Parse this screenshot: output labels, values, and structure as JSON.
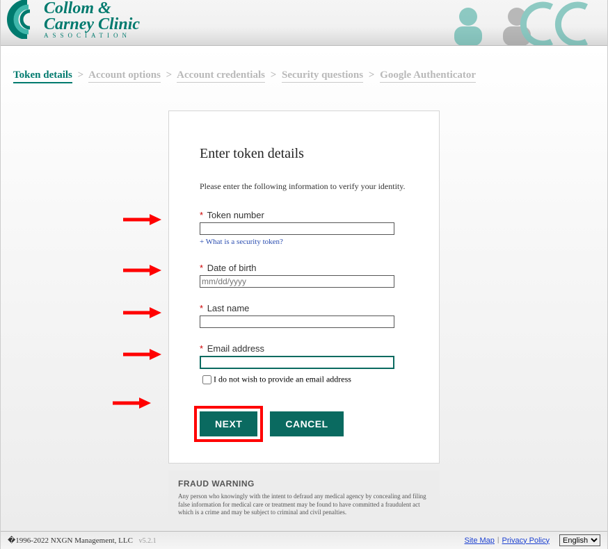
{
  "logo": {
    "line1": "Collom &",
    "line2": "Carney Clinic",
    "line3": "ASSOCIATION"
  },
  "breadcrumb": {
    "items": [
      {
        "label": "Token details",
        "active": true
      },
      {
        "label": "Account options",
        "active": false
      },
      {
        "label": "Account credentials",
        "active": false
      },
      {
        "label": "Security questions",
        "active": false
      },
      {
        "label": "Google Authenticator",
        "active": false
      }
    ],
    "separator": ">"
  },
  "form": {
    "heading": "Enter token details",
    "instruction": "Please enter the following information to verify your identity.",
    "required_mark": "*",
    "token": {
      "label": "Token number",
      "help": "+ What is a security token?"
    },
    "dob": {
      "label": "Date of birth",
      "placeholder": "mm/dd/yyyy"
    },
    "lastname": {
      "label": "Last name"
    },
    "email": {
      "label": "Email address"
    },
    "no_email_checkbox": "I do not wish to provide an email address",
    "next_btn": "NEXT",
    "cancel_btn": "CANCEL"
  },
  "fraud": {
    "title": "FRAUD WARNING",
    "text": "Any person who knowingly with the intent to defraud any medical agency by concealing and filing false information for medical care or treatment may be found to have committed a fraudulent act which is a crime and may be subject to criminal and civil penalties."
  },
  "footer": {
    "copyright": "�1996-2022 NXGN Management, LLC",
    "version": "v5.2.1",
    "sitemap": "Site Map",
    "privacy": "Privacy Policy",
    "lang": "English"
  }
}
